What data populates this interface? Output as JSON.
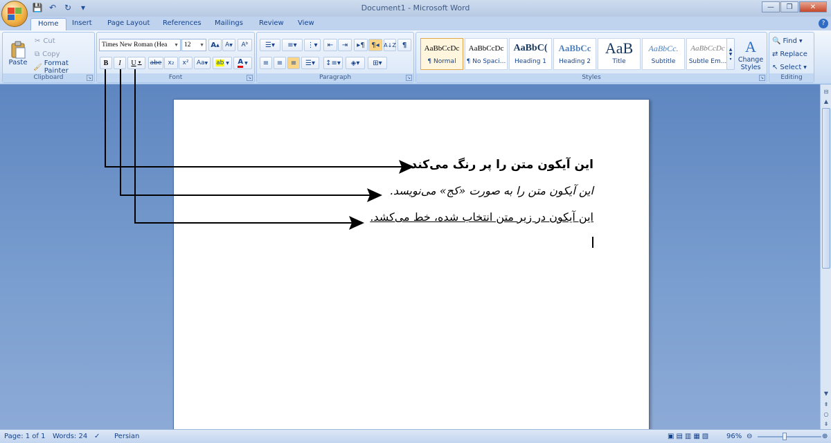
{
  "window": {
    "title": "Document1 - Microsoft Word",
    "controls": {
      "minimize": "—",
      "maximize": "❐",
      "close": "✕"
    }
  },
  "quick_access": {
    "save": "💾",
    "undo": "↶",
    "redo": "↻",
    "more": "▾"
  },
  "tabs": [
    {
      "label": "Home",
      "active": true
    },
    {
      "label": "Insert"
    },
    {
      "label": "Page Layout"
    },
    {
      "label": "References"
    },
    {
      "label": "Mailings"
    },
    {
      "label": "Review"
    },
    {
      "label": "View"
    }
  ],
  "clipboard": {
    "paste": "Paste",
    "cut": "Cut",
    "copy": "Copy",
    "format_painter": "Format Painter",
    "label": "Clipboard"
  },
  "font": {
    "name": "Times New Roman (Hea",
    "size": "12",
    "grow": "A",
    "shrink": "A",
    "clear": "Aᵇ",
    "bold": "B",
    "italic": "I",
    "underline": "U",
    "strike": "abe",
    "subscript": "x₂",
    "superscript": "x²",
    "case": "Aa",
    "highlight": "ab",
    "color": "A",
    "label": "Font"
  },
  "paragraph": {
    "label": "Paragraph",
    "show_marks": "¶",
    "sort": "A↓Z"
  },
  "styles": {
    "items": [
      {
        "sample": "AaBbCcDc",
        "name": "¶ Normal",
        "selected": true
      },
      {
        "sample": "AaBbCcDc",
        "name": "¶ No Spaci..."
      },
      {
        "sample": "AaBbC(",
        "name": "Heading 1"
      },
      {
        "sample": "AaBbCc",
        "name": "Heading 2"
      },
      {
        "sample": "AaB",
        "name": "Title"
      },
      {
        "sample": "AaBbCc.",
        "name": "Subtitle"
      },
      {
        "sample": "AaBbCcDc",
        "name": "Subtle Em..."
      }
    ],
    "change_styles": "Change Styles",
    "label": "Styles"
  },
  "editing": {
    "find": "Find",
    "replace": "Replace",
    "select": "Select",
    "label": "Editing"
  },
  "document": {
    "line1": "این آیکون متن را پر رنگ می‌کند.",
    "line2": "این آیکون متن را به صورت «کج» می‌نویسد.",
    "line3": "این آیکون در زیر متن انتخاب شده، خط می‌کشد."
  },
  "status": {
    "page": "Page: 1 of 1",
    "words": "Words: 24",
    "language": "Persian",
    "zoom": "96%"
  },
  "colors": {
    "highlight": "#ffff00",
    "font_color": "#e00000",
    "accent": "#15428b"
  }
}
